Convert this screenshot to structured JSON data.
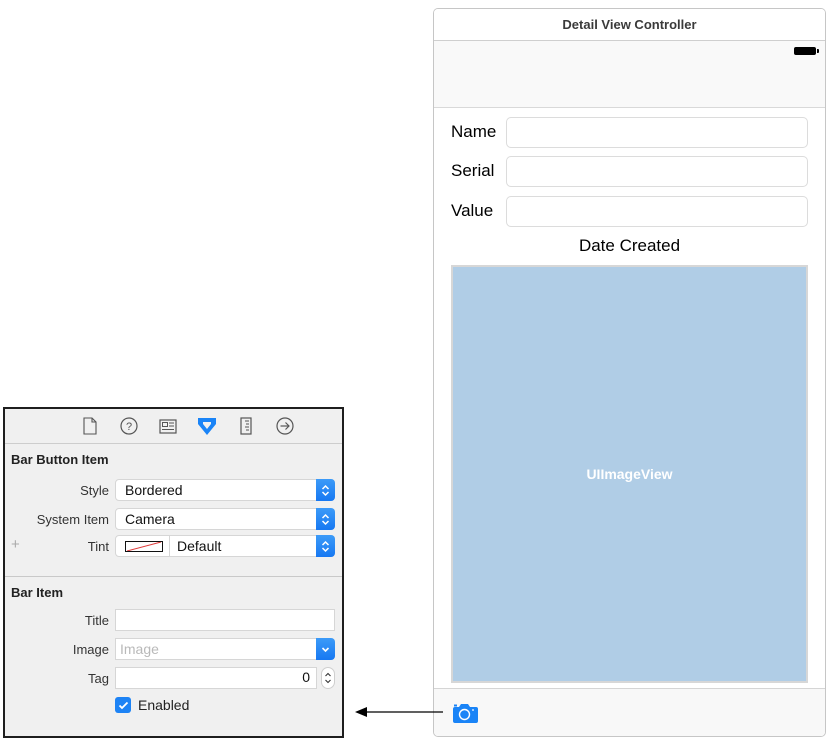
{
  "scene": {
    "title": "Detail View Controller",
    "fields": [
      {
        "label": "Name",
        "value": ""
      },
      {
        "label": "Serial",
        "value": ""
      },
      {
        "label": "Value",
        "value": ""
      }
    ],
    "date_label": "Date Created",
    "image_view_label": "UIImageView",
    "toolbar": {
      "item_icon": "camera-icon"
    }
  },
  "inspector": {
    "tabs": [
      {
        "icon": "file-icon"
      },
      {
        "icon": "help-icon"
      },
      {
        "icon": "identity-icon"
      },
      {
        "icon": "attributes-icon",
        "active": true
      },
      {
        "icon": "ruler-icon"
      },
      {
        "icon": "connections-icon"
      }
    ],
    "bar_button_item": {
      "title": "Bar Button Item",
      "style_label": "Style",
      "style_value": "Bordered",
      "system_item_label": "System Item",
      "system_item_value": "Camera",
      "tint_label": "Tint",
      "tint_value": "Default",
      "plus": "+"
    },
    "bar_item": {
      "title": "Bar Item",
      "title_label": "Title",
      "title_value": "",
      "image_label": "Image",
      "image_placeholder": "Image",
      "tag_label": "Tag",
      "tag_value": "0",
      "enabled_label": "Enabled",
      "enabled": true
    }
  },
  "colors": {
    "accent": "#1d83f5",
    "image_view_bg": "#b0cde6"
  }
}
